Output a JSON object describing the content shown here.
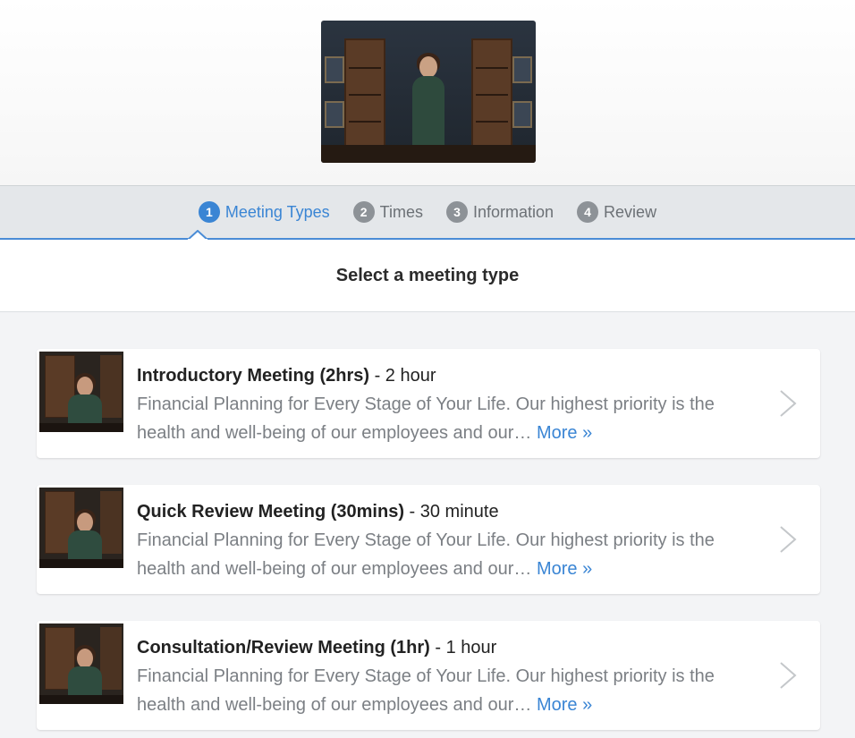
{
  "steps": [
    {
      "num": "1",
      "label": "Meeting Types",
      "active": true
    },
    {
      "num": "2",
      "label": "Times",
      "active": false
    },
    {
      "num": "3",
      "label": "Information",
      "active": false
    },
    {
      "num": "4",
      "label": "Review",
      "active": false
    }
  ],
  "page_title": "Select a meeting type",
  "meetings": [
    {
      "title": "Introductory Meeting (2hrs)",
      "duration": " - 2 hour",
      "description": "Financial Planning for Every Stage of Your Life. Our highest priority is the health and well-being of our employees and our…",
      "more_label": "More »"
    },
    {
      "title": "Quick Review Meeting (30mins)",
      "duration": " - 30 minute",
      "description": "Financial Planning for Every Stage of Your Life. Our highest priority is the health and well-being of our employees and our…",
      "more_label": "More »"
    },
    {
      "title": "Consultation/Review Meeting (1hr)",
      "duration": " - 1 hour",
      "description": "Financial Planning for Every Stage of Your Life. Our highest priority is the health and well-being of our employees and our…",
      "more_label": "More »"
    }
  ],
  "colors": {
    "accent": "#3a85d4",
    "inactive_step": "#8d9297",
    "muted_text": "#7b7f84"
  }
}
